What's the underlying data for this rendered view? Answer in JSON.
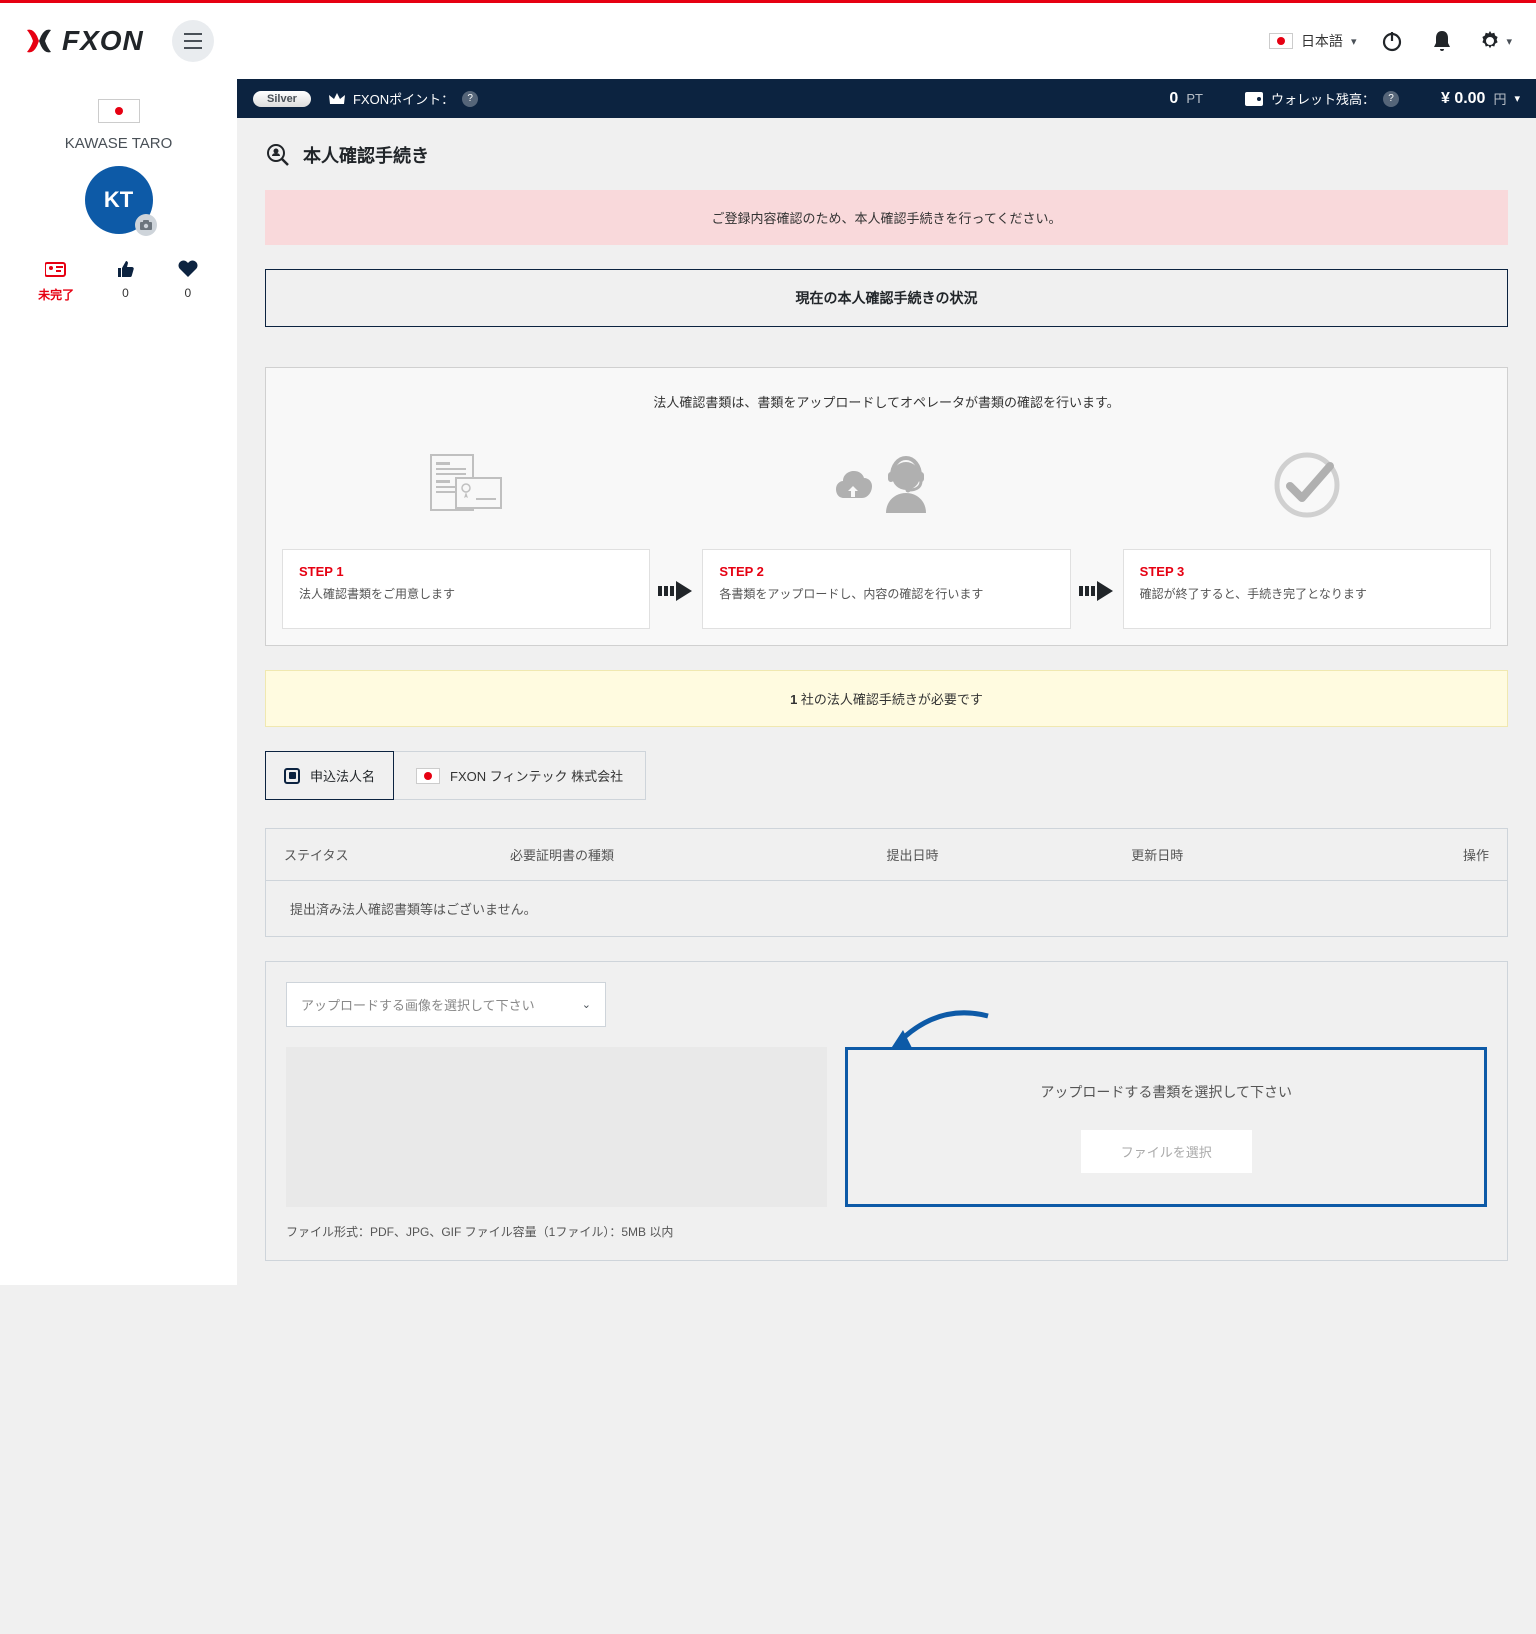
{
  "header": {
    "brand": "FXON",
    "language": "日本語"
  },
  "sidebar": {
    "username": "KAWASE TARO",
    "avatar_initials": "KT",
    "stats": {
      "incomplete_label": "未完了",
      "likes": "0",
      "hearts": "0"
    }
  },
  "infobar": {
    "tier": "Silver",
    "points_label": "FXONポイント：",
    "points_value": "0",
    "points_unit": "PT",
    "wallet_label": "ウォレット残高：",
    "wallet_value": "¥ 0.00",
    "wallet_unit": "円"
  },
  "page": {
    "title": "本人確認手続き",
    "notice_pink": "ご登録内容確認のため、本人確認手続きを行ってください。",
    "status_title": "現在の本人確認手続きの状況"
  },
  "process": {
    "intro": "法人確認書類は、書類をアップロードしてオペレータが書類の確認を行います。",
    "steps": [
      {
        "label": "STEP 1",
        "desc": "法人確認書類をご用意します"
      },
      {
        "label": "STEP 2",
        "desc": "各書類をアップロードし、内容の確認を行います"
      },
      {
        "label": "STEP 3",
        "desc": "確認が終了すると、手続き完了となります"
      }
    ]
  },
  "notice_yellow": {
    "count": "1",
    "text": " 社の法人確認手続きが必要です"
  },
  "company": {
    "label": "申込法人名",
    "name": "FXON フィンテック 株式会社"
  },
  "docs": {
    "headers": [
      "ステイタス",
      "必要証明書の種類",
      "提出日時",
      "更新日時",
      "操作"
    ],
    "empty_message": "提出済み法人確認書類等はございません。"
  },
  "upload": {
    "select_placeholder": "アップロードする画像を選択して下さい",
    "drop_title": "アップロードする書類を選択して下さい",
    "file_button": "ファイルを選択",
    "file_note": "ファイル形式：PDF、JPG、GIF ファイル容量（1ファイル）：5MB 以内"
  }
}
